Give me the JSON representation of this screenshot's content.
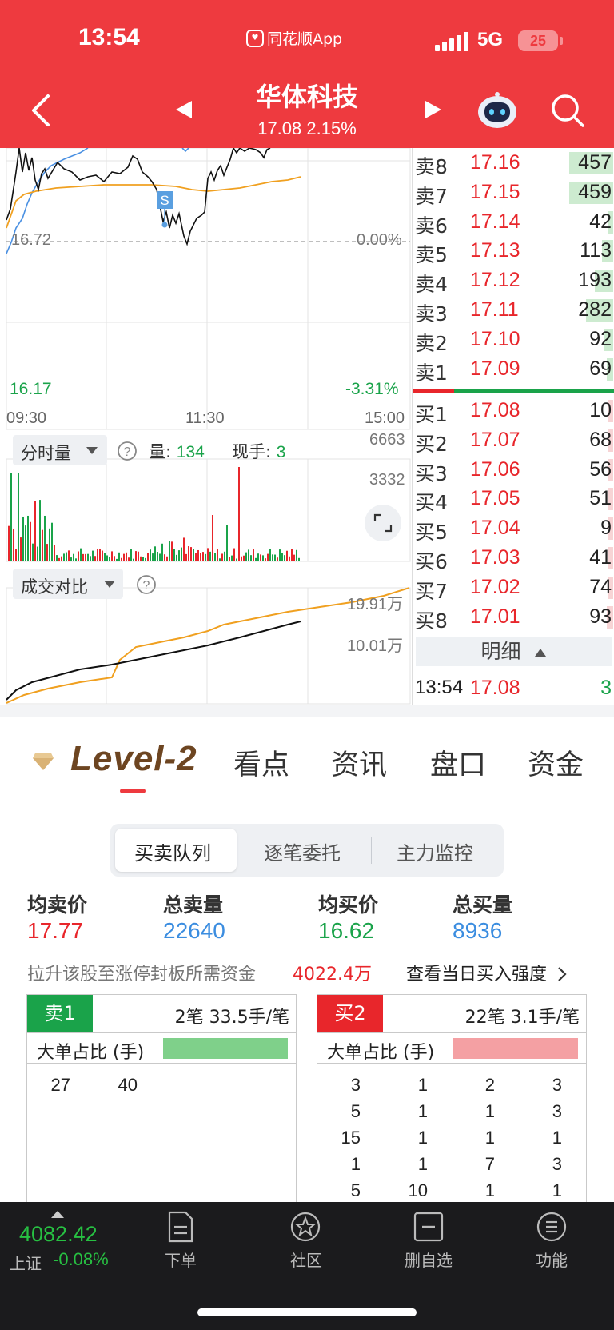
{
  "status_bar": {
    "time": "13:54",
    "app": "同花顺App",
    "network": "5G",
    "battery": "25"
  },
  "header": {
    "title": "华体科技",
    "price": "17.08",
    "change_pct": "2.15%"
  },
  "intraday": {
    "y_labels": {
      "ref_price": "16.72",
      "ref_pct": "0.00%",
      "low_price": "16.17",
      "low_pct": "-3.31%"
    },
    "x_labels": [
      "09:30",
      "11:30",
      "15:00"
    ],
    "trade_marker": "S",
    "colors": {
      "price_line": "#111111",
      "avg_line": "#f0a020",
      "index_line": "#4a90e2"
    }
  },
  "volume": {
    "selector": "分时量",
    "volume_label": "量:",
    "volume_value": "134",
    "current_label": "现手:",
    "current_value": "3",
    "scale_top": "6663",
    "scale_mid": "3332"
  },
  "compare": {
    "selector": "成交对比",
    "scale_top": "19.91万",
    "scale_mid": "10.01万"
  },
  "order_book": {
    "sell": [
      {
        "name": "卖8",
        "price": "17.16",
        "qty": "457",
        "level": 0.55
      },
      {
        "name": "卖7",
        "price": "17.15",
        "qty": "459",
        "level": 0.55
      },
      {
        "name": "卖6",
        "price": "17.14",
        "qty": "42",
        "level": 0.05
      },
      {
        "name": "卖5",
        "price": "17.13",
        "qty": "113",
        "level": 0.14
      },
      {
        "name": "卖4",
        "price": "17.12",
        "qty": "193",
        "level": 0.23
      },
      {
        "name": "卖3",
        "price": "17.11",
        "qty": "282",
        "level": 0.34
      },
      {
        "name": "卖2",
        "price": "17.10",
        "qty": "92",
        "level": 0.11
      },
      {
        "name": "卖1",
        "price": "17.09",
        "qty": "69",
        "level": 0.08
      }
    ],
    "buy": [
      {
        "name": "买1",
        "price": "17.08",
        "qty": "10",
        "level": 0.02
      },
      {
        "name": "买2",
        "price": "17.07",
        "qty": "68",
        "level": 0.06
      },
      {
        "name": "买3",
        "price": "17.06",
        "qty": "56",
        "level": 0.05
      },
      {
        "name": "买4",
        "price": "17.05",
        "qty": "51",
        "level": 0.05
      },
      {
        "name": "买5",
        "price": "17.04",
        "qty": "9",
        "level": 0.01
      },
      {
        "name": "买6",
        "price": "17.03",
        "qty": "41",
        "level": 0.04
      },
      {
        "name": "买7",
        "price": "17.02",
        "qty": "74",
        "level": 0.07
      },
      {
        "name": "买8",
        "price": "17.01",
        "qty": "93",
        "level": 0.08
      }
    ],
    "detail_label": "明细",
    "last_tick": {
      "time": "13:54",
      "price": "17.08",
      "volume": "3"
    }
  },
  "tabs": {
    "level2": "Level-2",
    "items": [
      "看点",
      "资讯",
      "盘口",
      "资金"
    ]
  },
  "segments": [
    "买卖队列",
    "逐笔委托",
    "主力监控"
  ],
  "stats": {
    "avg_sell_label": "均卖价",
    "avg_sell": "17.77",
    "total_sell_label": "总卖量",
    "total_sell": "22640",
    "avg_buy_label": "均买价",
    "avg_buy": "16.62",
    "total_buy_label": "总买量",
    "total_buy": "8936",
    "capital_label": "拉升该股至涨停封板所需资金",
    "capital_value": "4022.4万",
    "strength_link": "查看当日买入强度"
  },
  "queues": {
    "sell": {
      "tag": "卖1",
      "summary": "2笔   33.5手/笔",
      "big_order_label": "大单占比 (手)",
      "rows": [
        [
          "27",
          "40",
          "",
          ""
        ]
      ]
    },
    "buy": {
      "tag": "买2",
      "summary": "22笔   3.1手/笔",
      "big_order_label": "大单占比 (手)",
      "rows": [
        [
          "3",
          "1",
          "2",
          "3"
        ],
        [
          "5",
          "1",
          "1",
          "3"
        ],
        [
          "15",
          "1",
          "1",
          "1"
        ],
        [
          "1",
          "1",
          "7",
          "3"
        ],
        [
          "5",
          "10",
          "1",
          "1"
        ]
      ]
    }
  },
  "bottom_bar": {
    "index_value": "4082.42",
    "index_name": "上证",
    "index_change": "-0.08%",
    "items": [
      "下单",
      "社区",
      "删自选",
      "功能"
    ]
  }
}
